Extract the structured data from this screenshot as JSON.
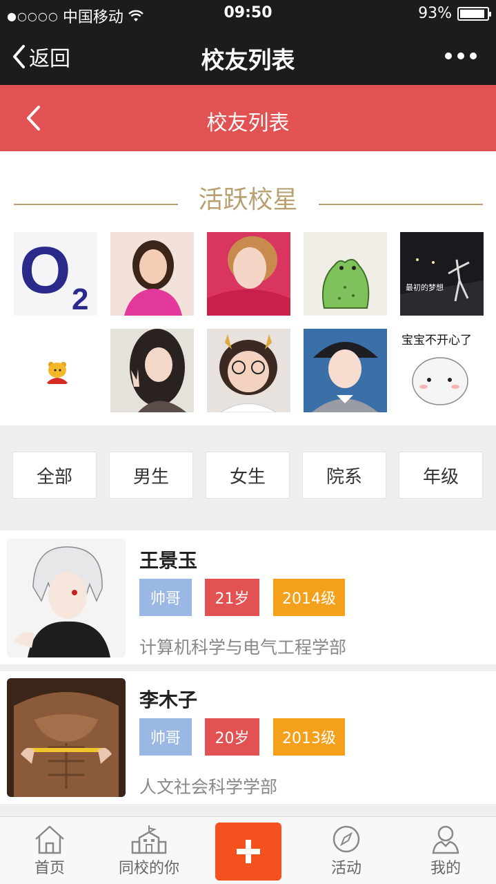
{
  "status_bar": {
    "signal_dots": "●○○○○",
    "carrier": "中国移动",
    "time": "09:50",
    "battery_percent": "93%",
    "battery_level": 0.93
  },
  "nav_bar": {
    "back_label": "返回",
    "title": "校友列表"
  },
  "page_header": {
    "title": "校友列表"
  },
  "section": {
    "title": "活跃校星"
  },
  "avatars": {
    "o2_text": "O",
    "o2_sub": "2",
    "sticker_text": "宝宝不开心了",
    "handwriting": "最初的梦想"
  },
  "filters": [
    "全部",
    "男生",
    "女生",
    "院系",
    "年级"
  ],
  "users": [
    {
      "name": "王景玉",
      "tags": [
        "帅哥",
        "21岁",
        "2014级"
      ],
      "department": "计算机科学与电气工程学部"
    },
    {
      "name": "李木子",
      "tags": [
        "帅哥",
        "20岁",
        "2013级"
      ],
      "department": "人文社会科学学部"
    }
  ],
  "tab_bar": {
    "items": [
      "首页",
      "同校的你",
      "活动",
      "我的"
    ]
  },
  "colors": {
    "accent_red": "#e25252",
    "gold": "#b8a070",
    "tag_blue": "#9bb7e3",
    "tag_orange": "#f5a01a",
    "plus_orange": "#f4511e"
  }
}
